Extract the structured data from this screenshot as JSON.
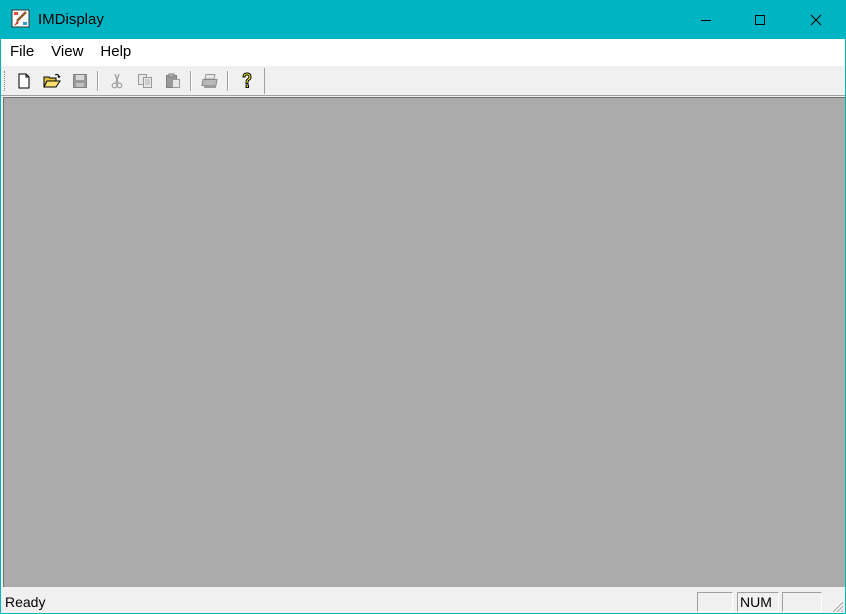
{
  "window": {
    "title": "IMDisplay",
    "icon": "paint-brush-app-icon",
    "controls": [
      "minimize-icon",
      "maximize-icon",
      "close-icon"
    ]
  },
  "menu": {
    "items": [
      {
        "label": "File"
      },
      {
        "label": "View"
      },
      {
        "label": "Help"
      }
    ]
  },
  "toolbar": {
    "buttons": [
      {
        "icon": "new-document-icon",
        "enabled": true
      },
      {
        "icon": "open-folder-icon",
        "enabled": true
      },
      {
        "icon": "save-disk-icon",
        "enabled": false
      },
      {
        "icon": "cut-scissors-icon",
        "enabled": false
      },
      {
        "icon": "copy-icon",
        "enabled": false
      },
      {
        "icon": "paste-icon",
        "enabled": false
      },
      {
        "icon": "print-icon",
        "enabled": false
      },
      {
        "icon": "help-question-icon",
        "enabled": true
      }
    ]
  },
  "status": {
    "text": "Ready",
    "panes": [
      "",
      "NUM",
      ""
    ]
  },
  "colors": {
    "titlebar": "#00b4c3",
    "client": "#ababab",
    "chrome": "#f0f0f0"
  }
}
